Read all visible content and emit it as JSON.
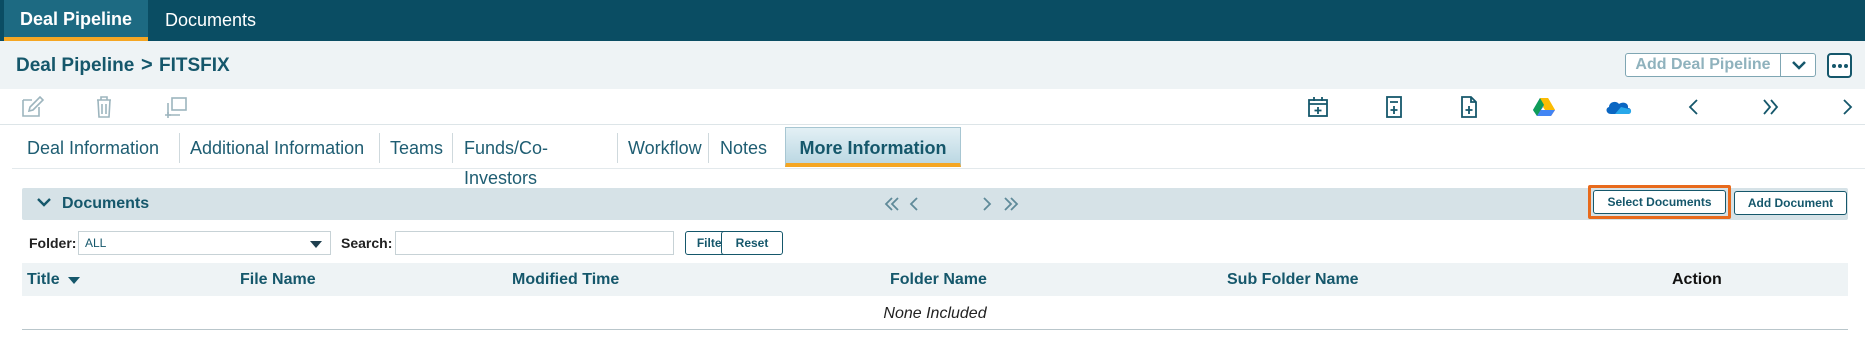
{
  "top_nav": {
    "tabs": [
      {
        "label": "Deal Pipeline",
        "active": true
      },
      {
        "label": "Documents",
        "active": false
      }
    ]
  },
  "breadcrumb": {
    "parent": "Deal Pipeline",
    "separator": ">",
    "current": "FITSFIX"
  },
  "header_actions": {
    "add_deal_pipeline": "Add Deal Pipeline"
  },
  "toolbar": {
    "left_icons": [
      "edit-icon",
      "trash-icon",
      "copy-icon"
    ],
    "right_icons": [
      "calendar-add-icon",
      "document-add-icon",
      "file-add-icon",
      "google-drive-icon",
      "onedrive-icon",
      "chevron-left-icon",
      "double-chevron-right-icon",
      "chevron-right-icon"
    ]
  },
  "sub_tabs": [
    {
      "label": "Deal Information"
    },
    {
      "label": "Additional Information"
    },
    {
      "label": "Teams"
    },
    {
      "label": "Funds/Co-Investors"
    },
    {
      "label": "Workflow"
    },
    {
      "label": "Notes"
    },
    {
      "label": "More Information",
      "active": true
    }
  ],
  "documents": {
    "title": "Documents",
    "select_button": "Select Documents",
    "add_button": "Add Document",
    "folder_label": "Folder:",
    "folder_value": "ALL",
    "search_label": "Search:",
    "search_value": "",
    "filter_button": "Filter",
    "reset_button": "Reset",
    "columns": [
      "Title",
      "File Name",
      "Modified Time",
      "Folder Name",
      "Sub Folder Name",
      "Action"
    ],
    "empty_text": "None Included"
  },
  "colors": {
    "nav_bg": "#0a4d63",
    "accent": "#f5a623",
    "highlight": "#e86a1c",
    "primary_text": "#15576b"
  }
}
